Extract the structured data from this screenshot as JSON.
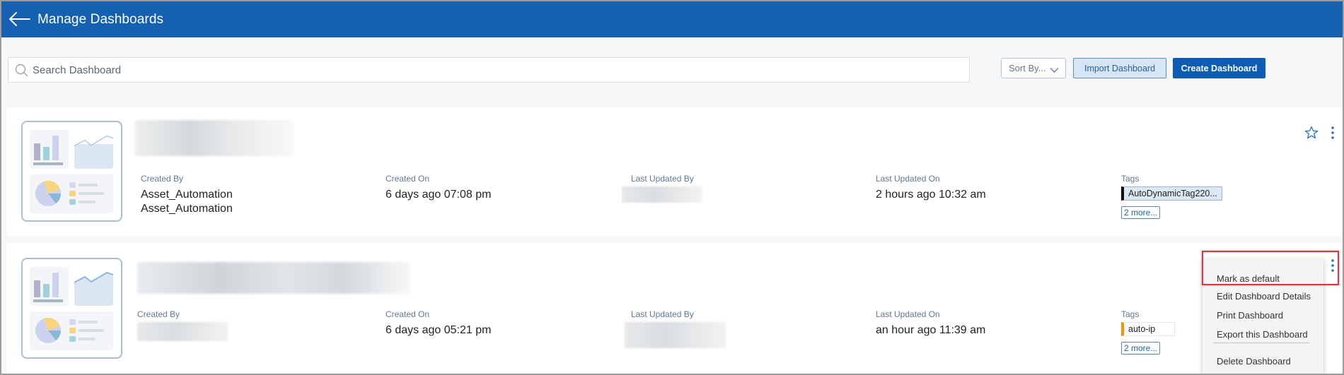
{
  "header": {
    "title": "Manage Dashboards",
    "back_icon": "arrow-left-icon",
    "background": "#1560b1"
  },
  "toolbar": {
    "search_placeholder": "Search Dashboard",
    "search_value": "",
    "sort_label": "Sort By...",
    "import_label": "Import Dashboard",
    "create_label": "Create Dashboard"
  },
  "columns": {
    "created_by": "Created By",
    "created_on": "Created On",
    "last_updated_by": "Last Updated By",
    "last_updated_on": "Last Updated On",
    "tags": "Tags"
  },
  "dashboards": [
    {
      "title": "",
      "title_redacted": true,
      "created_by": [
        "Asset_Automation",
        "Asset_Automation"
      ],
      "created_on": "6 days ago 07:08 pm",
      "last_updated_by_redacted": true,
      "last_updated_on": "2 hours ago 10:32 am",
      "tag": "AutoDynamicTag220...",
      "tag_color": "#111111",
      "tag_bg": "#dce8f4",
      "more_tags": "2 more...",
      "favorite": false
    },
    {
      "title": "",
      "title_redacted": true,
      "created_by_redacted": true,
      "created_on": "6 days ago 05:21 pm",
      "last_updated_by_redacted": true,
      "last_updated_on": "an hour ago 11:39 am",
      "tag": "auto-ip",
      "tag_color": "#f5940e",
      "tag_bg": "#ffffff",
      "more_tags": "2 more..."
    }
  ],
  "context_menu": {
    "items": [
      "Mark as default",
      "Edit Dashboard Details",
      "Print Dashboard",
      "Export this Dashboard",
      "Delete Dashboard"
    ],
    "highlighted": "Mark as default",
    "highlight_color": "#e4343c"
  }
}
